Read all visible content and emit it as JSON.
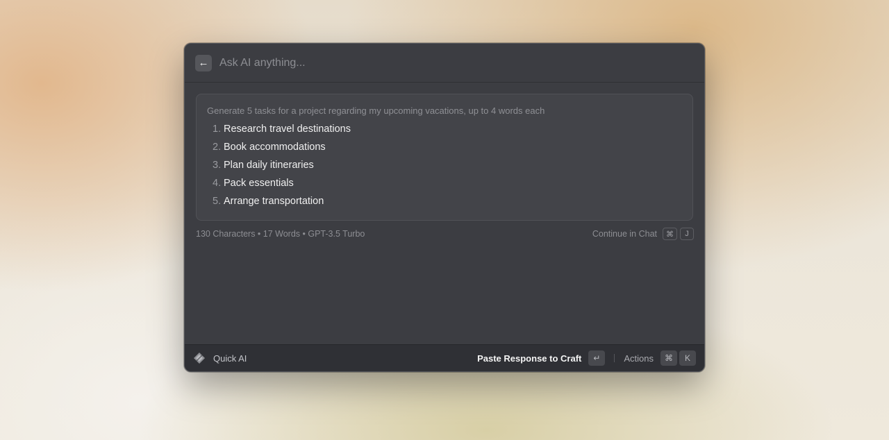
{
  "header": {
    "back_icon": "arrow-left-icon",
    "search_placeholder": "Ask AI anything...",
    "search_value": ""
  },
  "response": {
    "prompt": "Generate 5 tasks for a project regarding my upcoming vacations, up to 4 words each",
    "tasks": [
      {
        "num": "1.",
        "text": "Research travel destinations"
      },
      {
        "num": "2.",
        "text": "Book accommodations"
      },
      {
        "num": "3.",
        "text": "Plan daily itineraries"
      },
      {
        "num": "4.",
        "text": "Pack essentials"
      },
      {
        "num": "5.",
        "text": "Arrange transportation"
      }
    ]
  },
  "meta": {
    "text": "130 Characters • 17 Words • GPT-3.5 Turbo",
    "continue_label": "Continue in Chat",
    "continue_keys": [
      "⌘",
      "J"
    ]
  },
  "footer": {
    "app_icon": "quick-ai-sparkle-icon",
    "title": "Quick AI",
    "primary_action": "Paste Response to Craft",
    "primary_key": "↵",
    "actions_label": "Actions",
    "actions_keys": [
      "⌘",
      "K"
    ]
  }
}
